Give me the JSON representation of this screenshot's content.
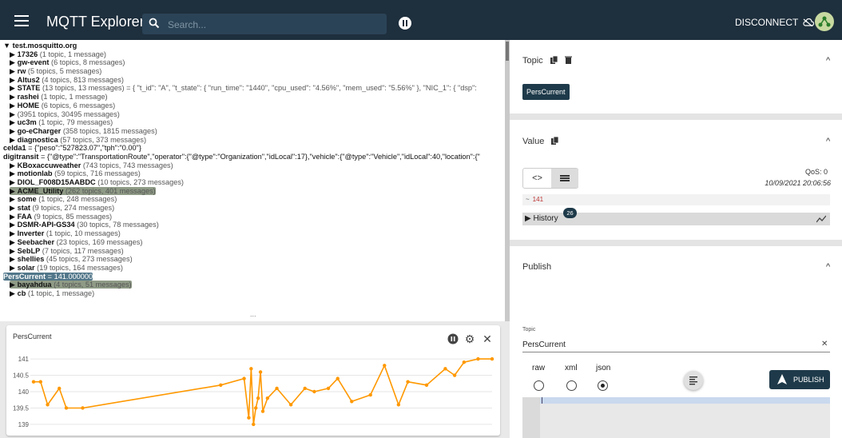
{
  "app": {
    "title": "MQTT Explorer",
    "disconnect": "DISCONNECT"
  },
  "search": {
    "placeholder": "Search..."
  },
  "tree": {
    "root": "test.mosquitto.org",
    "rows": [
      {
        "name": "17326",
        "meta": "(1 topic, 1 message)"
      },
      {
        "name": "gw-event",
        "meta": "(6 topics, 8 messages)"
      },
      {
        "name": "rw",
        "meta": "(5 topics, 5 messages)"
      },
      {
        "name": "Altus2",
        "meta": "(4 topics, 813 messages)"
      },
      {
        "name": "STATE",
        "meta": "(13 topics, 13 messages) = { \"t_id\": \"A\", \"t_state\": { \"run_time\": \"1440\", \"cpu_used\": \"4.56%\", \"mem_used\": \"5.56%\" }, \"NIC_1\": { \"dsp\":"
      },
      {
        "name": "rashei",
        "meta": "(1 topic, 1 message)"
      },
      {
        "name": "HOME",
        "meta": "(6 topics, 6 messages)"
      },
      {
        "name": "",
        "meta": "(3951 topics, 30495 messages)"
      },
      {
        "name": "uc3m",
        "meta": "(1 topic, 79 messages)"
      },
      {
        "name": "go-eCharger",
        "meta": "(358 topics, 1815 messages)"
      },
      {
        "name": "diagnostica",
        "meta": "(57 topics, 373 messages)"
      }
    ],
    "leaf_rows": [
      {
        "name": "celda1",
        "meta": " = {\"peso\":\"527823.07\",\"tph\":\"0.00\"}"
      },
      {
        "name": "digitransit",
        "meta": " = {\"@type\":\"TransportationRoute\",\"operator\":{\"@type\":\"Organization\",\"idLocal\":17},\"vehicle\":{\"@type\":\"Vehicle\",\"idLocal\":40,\"location\":{\""
      }
    ],
    "rows2": [
      {
        "name": "KBoxaccuweather",
        "meta": "(743 topics, 743 messages)"
      },
      {
        "name": "motionlab",
        "meta": "(59 topics, 716 messages)"
      },
      {
        "name": "DIOL_F008D15AABDC",
        "meta": "(10 topics, 273 messages)"
      },
      {
        "name": "ACME_Utility",
        "meta": "(262 topics, 401 messages)"
      },
      {
        "name": "some",
        "meta": "(1 topic, 248 messages)"
      },
      {
        "name": "stat",
        "meta": "(9 topics, 274 messages)"
      },
      {
        "name": "FAA",
        "meta": "(9 topics, 85 messages)"
      },
      {
        "name": "DSMR-API-GS34",
        "meta": "(30 topics, 78 messages)"
      },
      {
        "name": "Inverter",
        "meta": "(1 topic, 10 messages)"
      },
      {
        "name": "Seebacher",
        "meta": "(23 topics, 169 messages)"
      },
      {
        "name": "SebLP",
        "meta": "(7 topics, 117 messages)"
      },
      {
        "name": "shellies",
        "meta": "(45 topics, 273 messages)"
      },
      {
        "name": "solar",
        "meta": "(19 topics, 164 messages)"
      }
    ],
    "selected": {
      "name": "PersCurrent",
      "meta": " = 141.000000"
    },
    "rows3": [
      {
        "name": "bayahdua",
        "meta": "(4 topics, 51 messages)"
      },
      {
        "name": "cb",
        "meta": "(1 topic, 1 message)"
      }
    ],
    "more": "..."
  },
  "chart_data": {
    "type": "line",
    "title": "PersCurrent",
    "xlabel": "",
    "ylabel": "",
    "ylim": [
      138.9,
      141.1
    ],
    "yticks": [
      141,
      140.5,
      140,
      139.5,
      139
    ],
    "color": "#ff9800",
    "x": [
      0,
      1.5,
      3,
      5.5,
      7,
      10.5,
      40,
      45,
      46,
      46.5,
      47,
      47.5,
      48,
      48.5,
      49,
      50,
      52,
      55,
      58,
      60,
      63,
      65,
      68,
      72,
      75,
      78,
      80,
      84,
      88,
      90,
      92,
      95,
      98
    ],
    "values": [
      140.3,
      140.3,
      139.6,
      140.1,
      139.5,
      139.5,
      140.2,
      140.4,
      139.2,
      140.7,
      139.0,
      139.5,
      139.8,
      140.6,
      139.4,
      139.8,
      140.1,
      139.6,
      140.1,
      140.0,
      140.1,
      140.4,
      139.7,
      139.9,
      140.8,
      139.6,
      140.3,
      140.2,
      140.7,
      140.5,
      140.9,
      141.0,
      141.0
    ]
  },
  "right": {
    "topic_title": "Topic",
    "topic_chip": "PersCurrent",
    "value_title": "Value",
    "qos": "QoS: 0",
    "timestamp": "10/09/2021 20:06:56",
    "value": "141",
    "history_label": "History",
    "history_count": "26",
    "publish_title": "Publish",
    "topic_field_label": "Topic",
    "topic_field_value": "PersCurrent",
    "formats": [
      "raw",
      "xml",
      "json"
    ],
    "selected_format": "json",
    "publish_button": "PUBLISH",
    "colors": {
      "primary": "#1e3a4a",
      "topbar": "#1e2f3d",
      "chart": "#ff9800"
    }
  }
}
